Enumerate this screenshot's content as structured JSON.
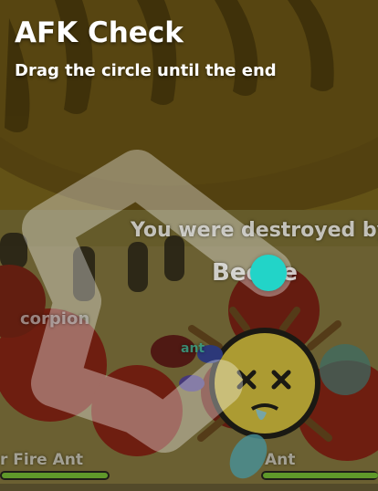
{
  "afk_check": {
    "title": "AFK Check",
    "instruction": "Drag the circle until the end"
  },
  "game": {
    "death_message": "You were destroyed by",
    "killer_name": "Beetle",
    "nearby_labels": [
      "corpion",
      "r Fire Ant",
      "Ant",
      "ant"
    ]
  },
  "colors": {
    "handle": "#22d4c8",
    "path": "#ffffff",
    "background": "#6e5a17"
  }
}
